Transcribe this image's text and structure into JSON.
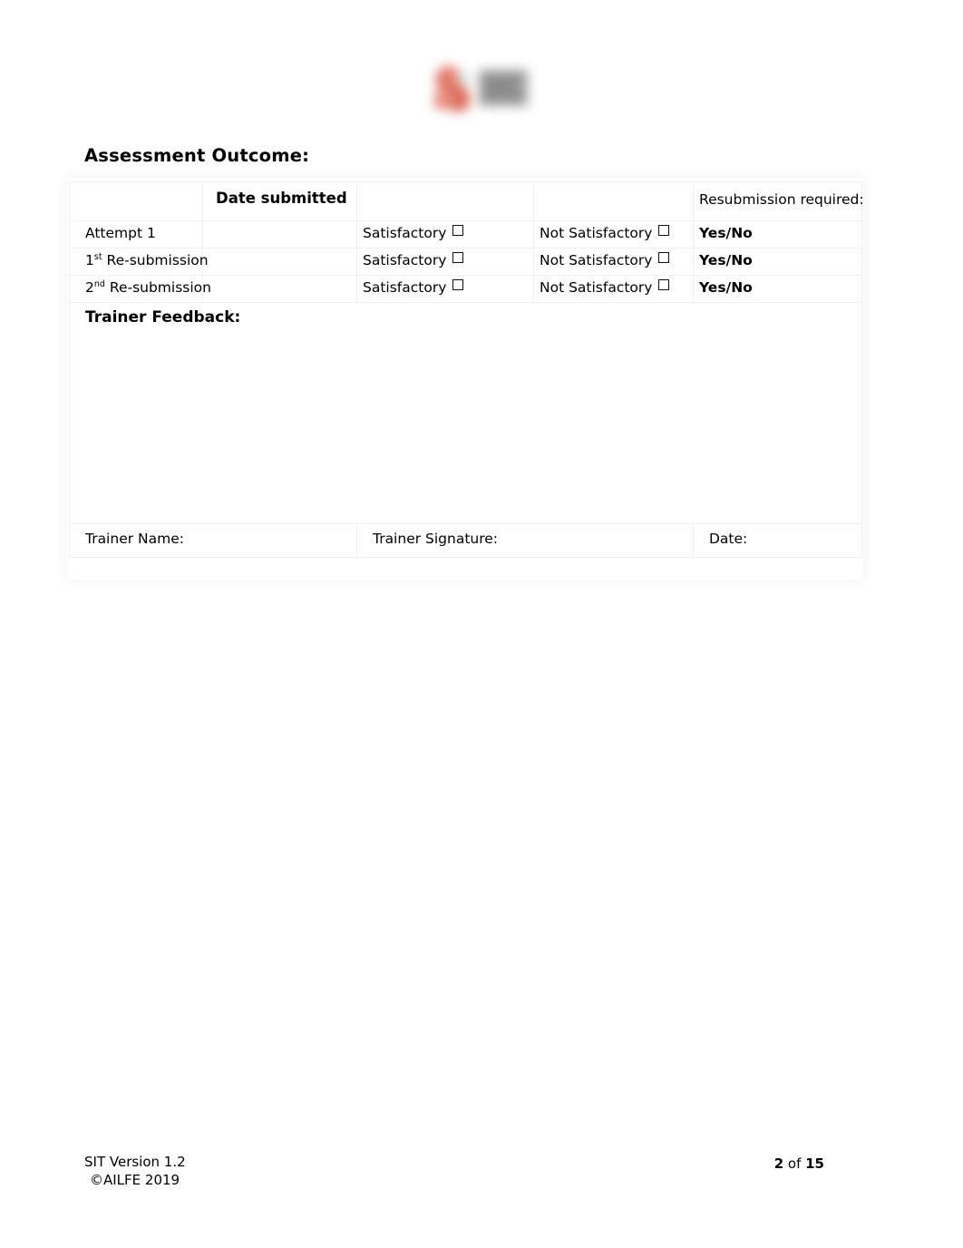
{
  "document": {
    "section_title": "Assessment Outcome:"
  },
  "logo": {
    "name": "organisation-logo"
  },
  "table": {
    "headers": {
      "blank": "",
      "date_submitted": "Date submitted",
      "sat_blank": "",
      "notsat_blank": "",
      "resubmission_required": "Resubmission required:"
    },
    "rows": [
      {
        "attempt": "Attempt 1",
        "attempt_sup": "",
        "attempt_rest": "",
        "date_value": "",
        "satisfactory": "Satisfactory",
        "not_satisfactory": "Not Satisfactory",
        "yes_no": "Yes/No"
      },
      {
        "attempt": "1",
        "attempt_sup": "st",
        "attempt_rest": "  Re-submission",
        "date_value": "",
        "satisfactory": "Satisfactory",
        "not_satisfactory": "Not Satisfactory",
        "yes_no": "Yes/No"
      },
      {
        "attempt": "2",
        "attempt_sup": "nd",
        "attempt_rest": " Re-submission",
        "date_value": "",
        "satisfactory": "Satisfactory",
        "not_satisfactory": "Not Satisfactory",
        "yes_no": "Yes/No"
      }
    ],
    "feedback": {
      "title": "Trainer Feedback:",
      "value": ""
    },
    "signature": {
      "trainer_name_label": "Trainer Name:",
      "trainer_name_value": "",
      "trainer_signature_label": "Trainer Signature:",
      "trainer_signature_value": "",
      "date_label": "Date:",
      "date_value": ""
    }
  },
  "footer": {
    "version": "SIT Version 1.2",
    "copyright": "©AILFE 2019",
    "page_current": "2",
    "page_of": " of ",
    "page_total": "15"
  }
}
